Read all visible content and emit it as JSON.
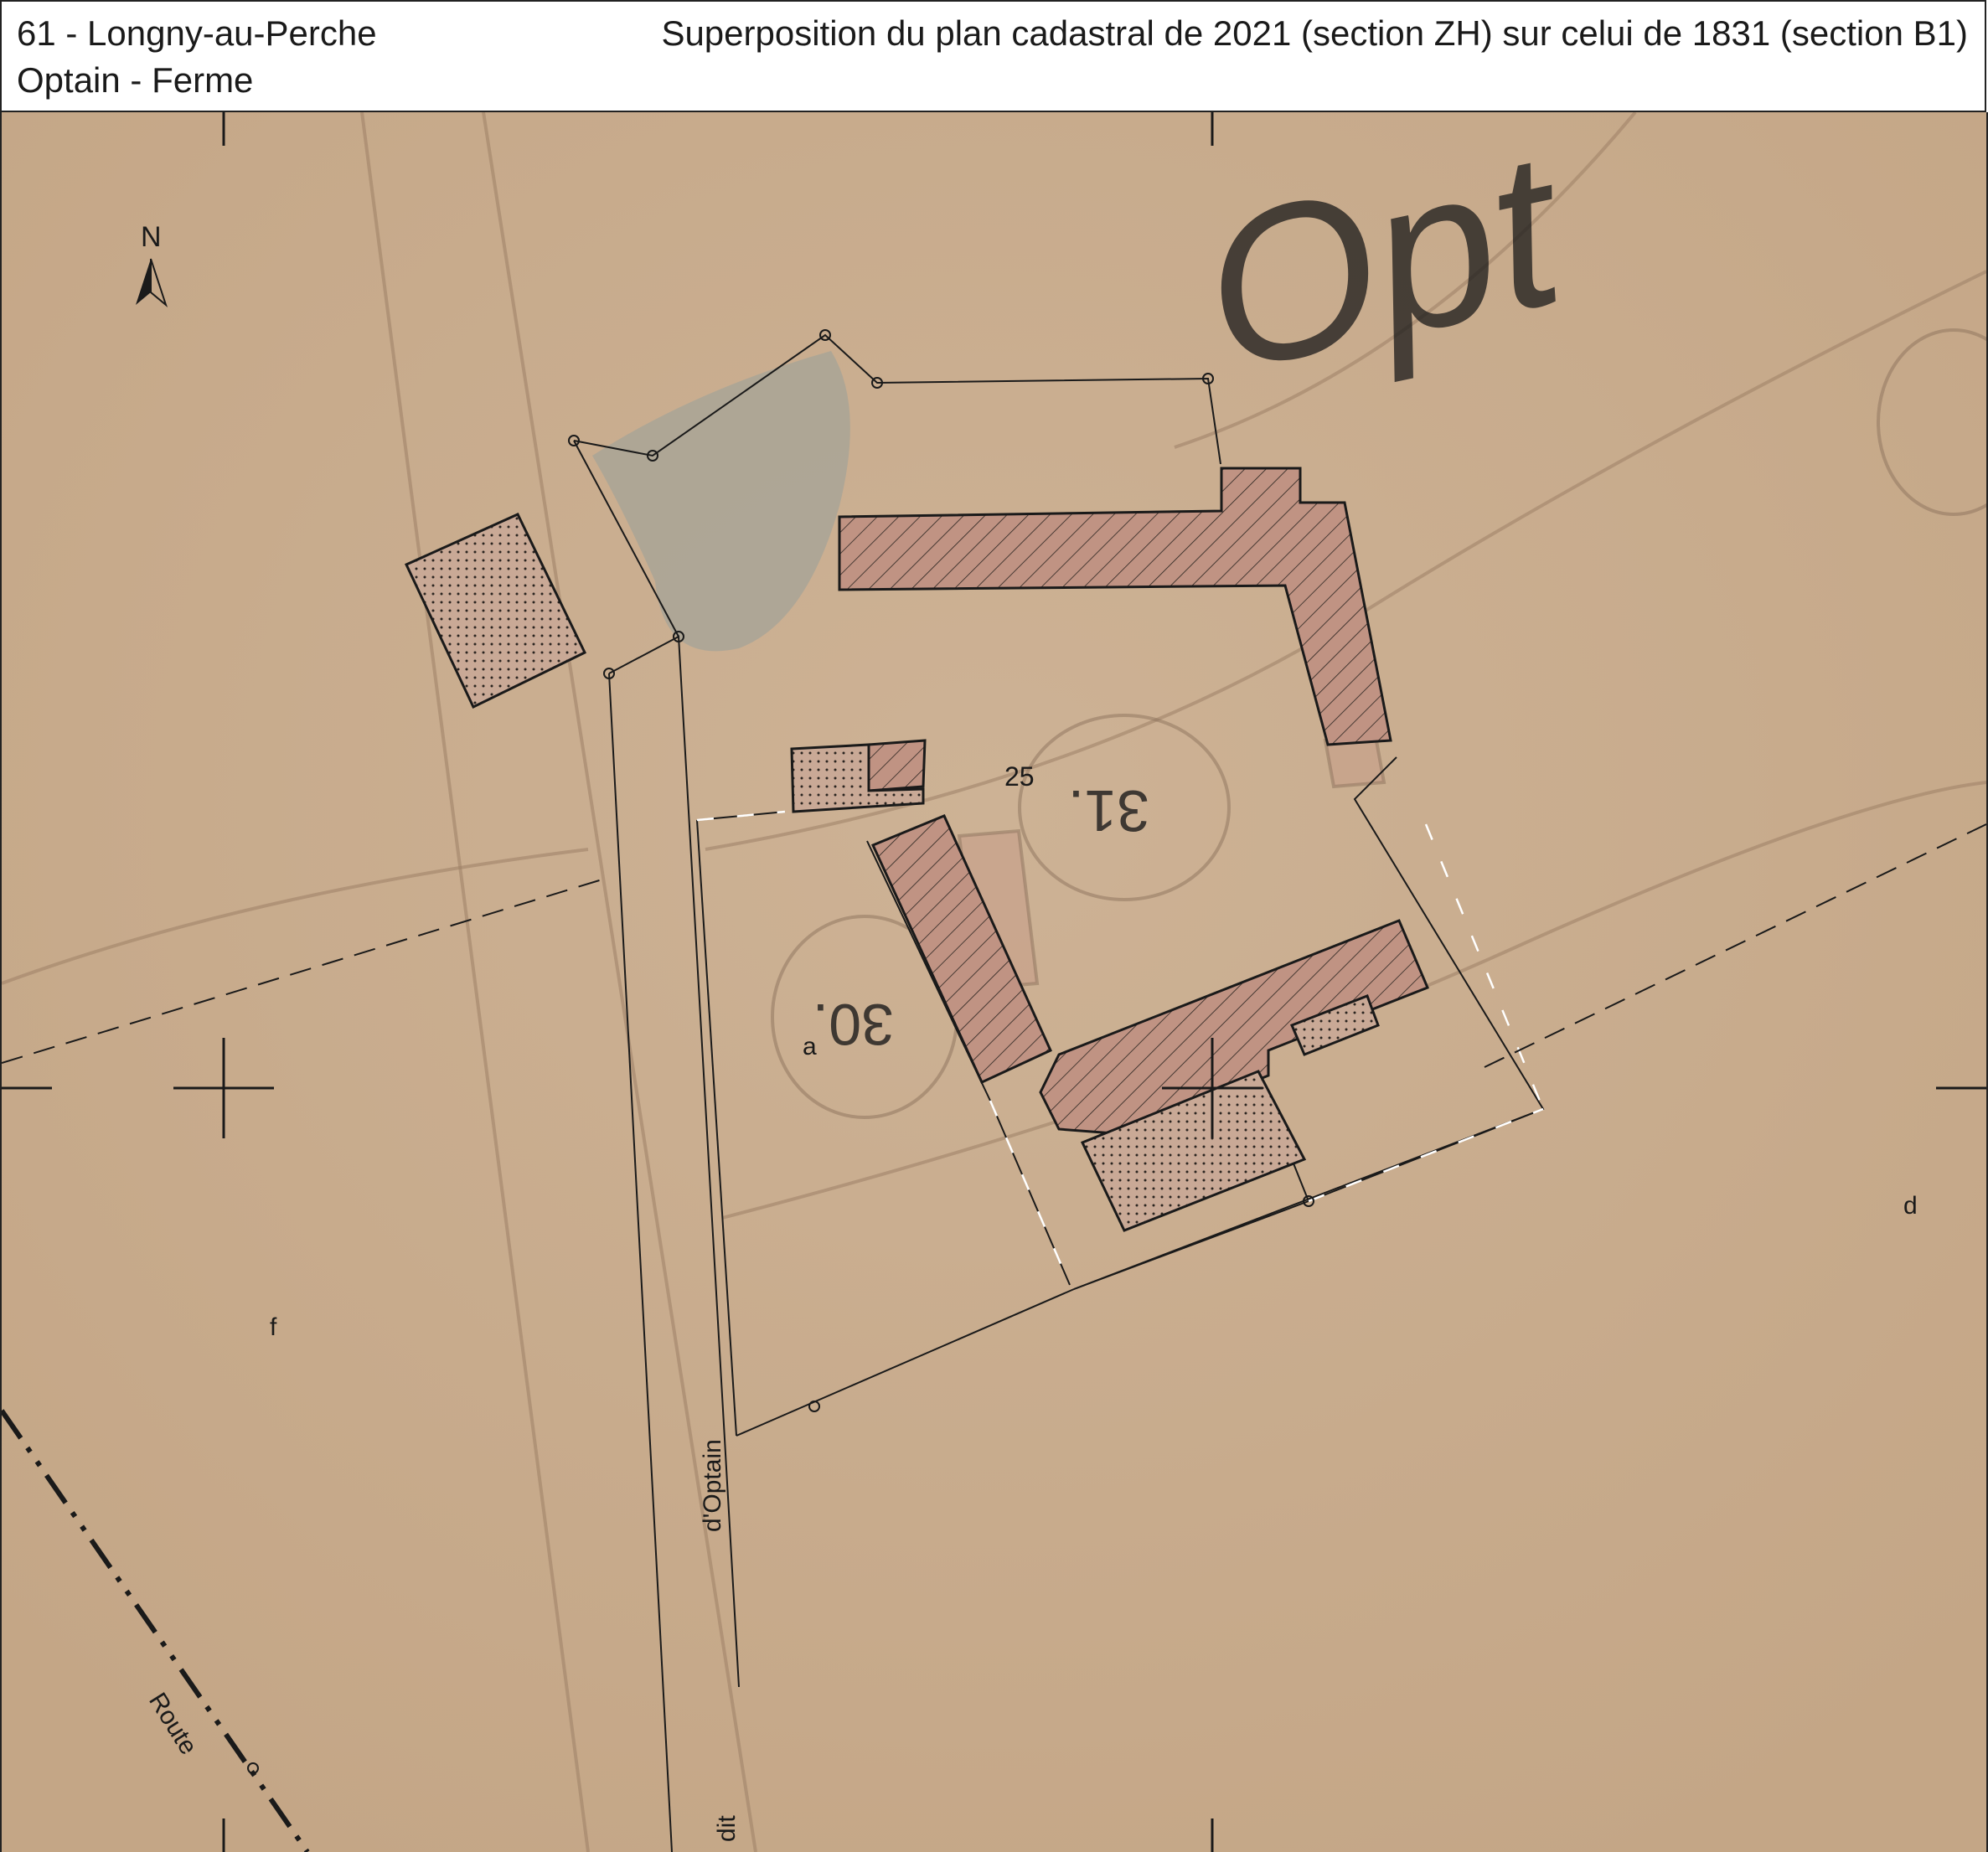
{
  "header": {
    "commune": "61 - Longny-au-Perche",
    "place": "Optain - Ferme",
    "title": "Superposition du plan cadastral de 2021 (section ZH) sur celui de 1831 (section B1)"
  },
  "map": {
    "north_label": "N",
    "parcel_number": "25",
    "parcel_letters": [
      "a",
      "d",
      "f"
    ],
    "old_plan_numbers": [
      "30.",
      "31."
    ],
    "old_plan_lettering": "Opt",
    "road_labels": [
      "d'Optain",
      "dit",
      "Route"
    ],
    "colors": {
      "background": "#c9ac8e",
      "building_fill": "#c09383",
      "pond": "#a9a596",
      "outline": "#1a1a1a"
    }
  }
}
